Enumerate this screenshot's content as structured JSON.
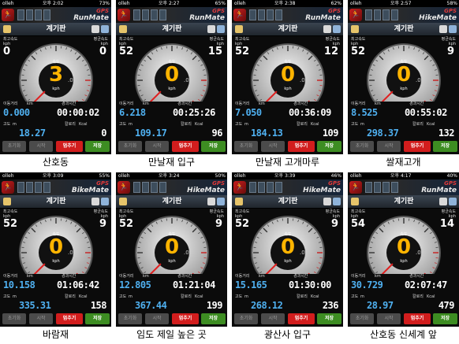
{
  "labels": {
    "title": "계기판",
    "max_speed": "최고속도",
    "avg_speed": "평균속도",
    "speed": "속도",
    "kph": "kph",
    "distance": "이동거리",
    "km": "km",
    "elapsed": "경과시간",
    "altitude": "고도",
    "m": "m",
    "calorie": "칼로리",
    "kcal": "Kcal",
    "btn_reset": "초기화",
    "btn_start": "시작",
    "btn_stop": "멈추기",
    "btn_save": "저장"
  },
  "colors": {
    "speed": "#ffb400",
    "value": "#4fb0f0",
    "stop": "#d21d1d",
    "save": "#3d8d22"
  },
  "panels": [
    {
      "carrier": "olleh",
      "time": "오후 2:02",
      "battery": "73%",
      "app": "RunMate",
      "max": "0",
      "avg": "0",
      "speed": "3",
      "decimal": ".0",
      "distance": "0.000",
      "elapsed": "00:00:02",
      "altitude": "18.27",
      "calorie": "0",
      "caption": "산호동"
    },
    {
      "carrier": "olleh",
      "time": "오후 2:27",
      "battery": "65%",
      "app": "RunMate",
      "max": "52",
      "avg": "15",
      "speed": "0",
      "decimal": ".0",
      "distance": "6.218",
      "elapsed": "00:25:26",
      "altitude": "109.17",
      "calorie": "96",
      "caption": "만날재 입구"
    },
    {
      "carrier": "olleh",
      "time": "오후 2:38",
      "battery": "62%",
      "app": "RunMate",
      "max": "52",
      "avg": "12",
      "speed": "0",
      "decimal": ".0",
      "distance": "7.050",
      "elapsed": "00:36:09",
      "altitude": "184.13",
      "calorie": "109",
      "caption": "만날재 고개마루"
    },
    {
      "carrier": "olleh",
      "time": "오후 2:57",
      "battery": "58%",
      "app": "HikeMate",
      "max": "52",
      "avg": "9",
      "speed": "0",
      "decimal": ".0",
      "distance": "8.525",
      "elapsed": "00:55:02",
      "altitude": "298.37",
      "calorie": "132",
      "caption": "쌀재고개"
    },
    {
      "carrier": "olleh",
      "time": "오후 3:09",
      "battery": "55%",
      "app": "BikeMate",
      "max": "52",
      "avg": "9",
      "speed": "0",
      "decimal": ".0",
      "distance": "10.158",
      "elapsed": "01:06:42",
      "altitude": "335.31",
      "calorie": "158",
      "caption": "바람재"
    },
    {
      "carrier": "olleh",
      "time": "오후 3:24",
      "battery": "50%",
      "app": "HikeMate",
      "max": "52",
      "avg": "9",
      "speed": "0",
      "decimal": ".0",
      "distance": "12.805",
      "elapsed": "01:21:04",
      "altitude": "367.44",
      "calorie": "199",
      "caption": "임도 제일 높은 곳"
    },
    {
      "carrier": "olleh",
      "time": "오후 3:39",
      "battery": "46%",
      "app": "HikeMate",
      "max": "52",
      "avg": "9",
      "speed": "0",
      "decimal": ".0",
      "distance": "15.165",
      "elapsed": "01:30:00",
      "altitude": "268.12",
      "calorie": "236",
      "caption": "광산사 입구"
    },
    {
      "carrier": "olleh",
      "time": "오후 4:17",
      "battery": "40%",
      "app": "RunMate",
      "max": "54",
      "avg": "14",
      "speed": "0",
      "decimal": ".0",
      "distance": "30.729",
      "elapsed": "02:07:47",
      "altitude": "28.97",
      "calorie": "479",
      "caption": "산호동 신세계 앞"
    }
  ]
}
